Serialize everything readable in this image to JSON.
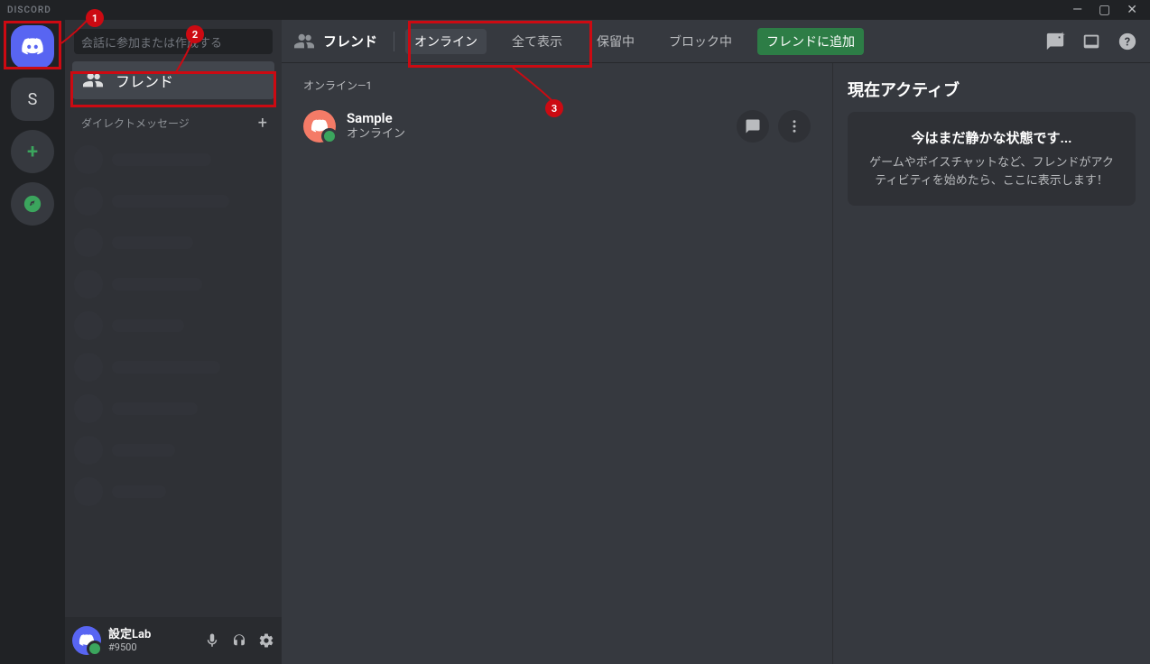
{
  "titlebar": {
    "label": "DISCORD"
  },
  "server_rail": {
    "home_tooltip": "ホーム",
    "server_initial": "S",
    "add_label": "+",
    "explore_label": "探す"
  },
  "sidebar": {
    "search_placeholder": "会話に参加または作成する",
    "friends_label": "フレンド",
    "dm_header": "ダイレクトメッセージ"
  },
  "user_panel": {
    "name": "設定Lab",
    "tag": "#9500"
  },
  "topbar": {
    "title": "フレンド",
    "tabs": {
      "online": "オンライン",
      "all": "全て表示",
      "pending": "保留中",
      "blocked": "ブロック中",
      "add_friend": "フレンドに追加"
    }
  },
  "friends": {
    "section_title": "オンライン—1",
    "list": [
      {
        "name": "Sample",
        "status": "オンライン"
      }
    ]
  },
  "now_playing": {
    "title": "現在アクティブ",
    "empty_heading": "今はまだ静かな状態です...",
    "empty_body": "ゲームやボイスチャットなど、フレンドがアクティビティを始めたら、ここに表示します！"
  },
  "annotations": {
    "b1": "1",
    "b2": "2",
    "b3": "3"
  }
}
